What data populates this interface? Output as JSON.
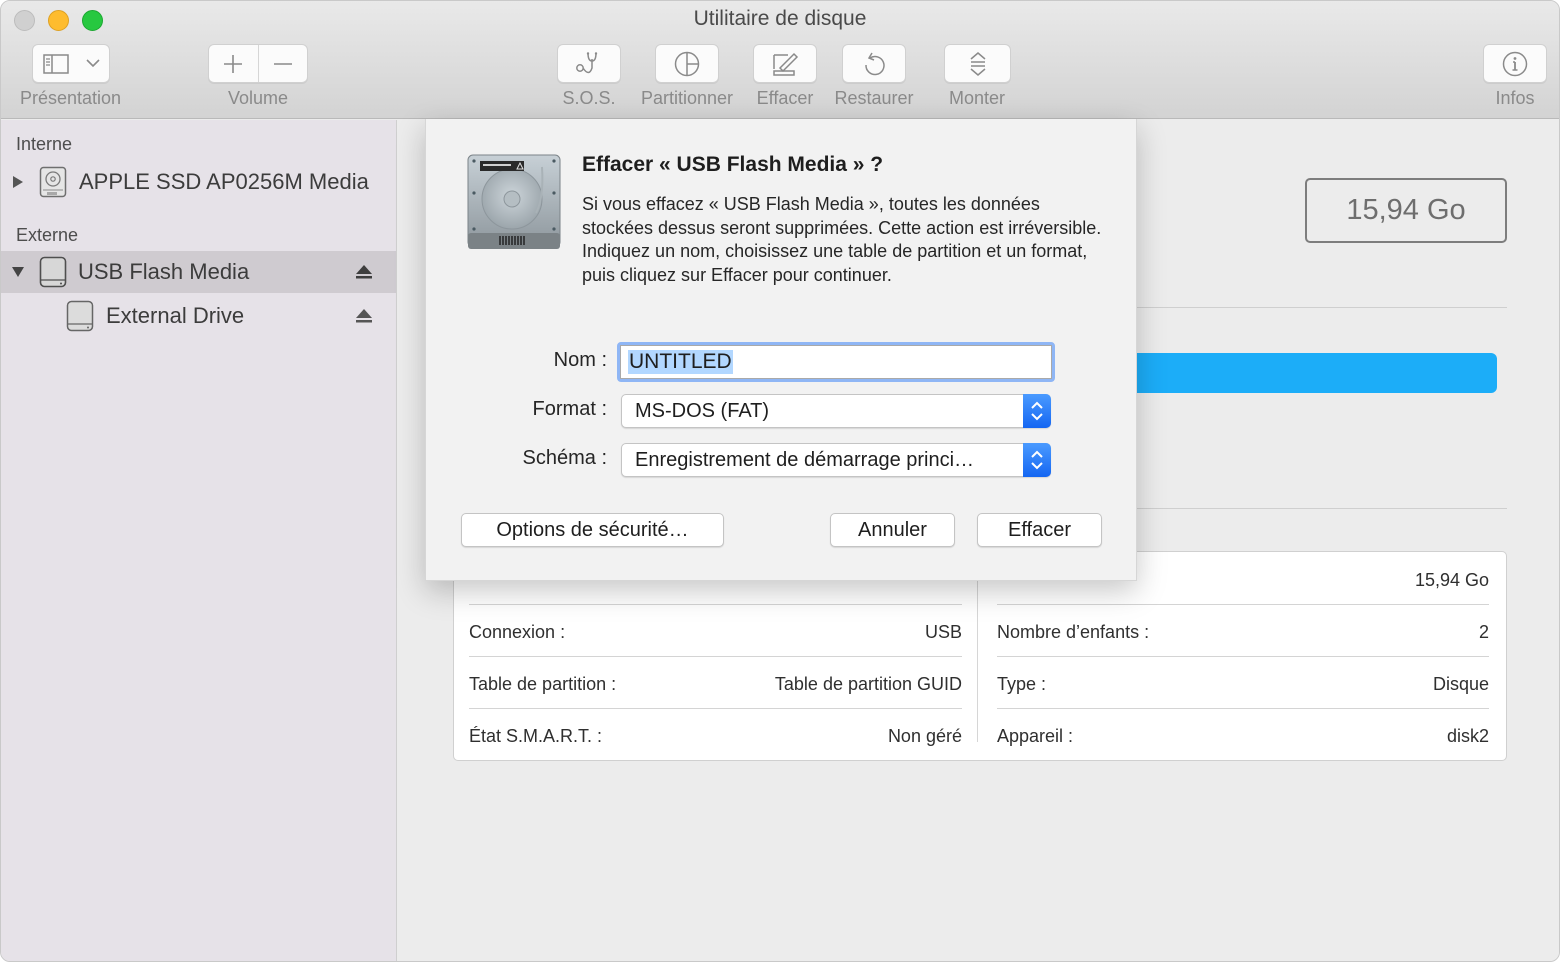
{
  "window": {
    "title": "Utilitaire de disque"
  },
  "toolbar": {
    "presentation_label": "Présentation",
    "volume_label": "Volume",
    "sos_label": "S.O.S.",
    "partition_label": "Partitionner",
    "erase_label": "Effacer",
    "restore_label": "Restaurer",
    "mount_label": "Monter",
    "info_label": "Infos",
    "icons": {
      "presentation": "sidebar-icon",
      "presentation_menu": "chevron-down-icon",
      "volume_add": "plus-icon",
      "volume_remove": "minus-icon",
      "sos": "stethoscope-icon",
      "partition": "pie-chart-icon",
      "erase": "erase-icon",
      "restore": "restore-arrow-icon",
      "mount": "mount-icon",
      "info": "info-icon"
    }
  },
  "sidebar": {
    "sections": [
      {
        "title": "Interne",
        "items": [
          {
            "label": "APPLE SSD AP0256M Media",
            "expanded": false,
            "icon": "internal-disk-icon",
            "selected": false
          }
        ]
      },
      {
        "title": "Externe",
        "items": [
          {
            "label": "USB Flash Media",
            "expanded": true,
            "icon": "external-disk-icon",
            "selected": true,
            "ejectable": true
          },
          {
            "label": "External Drive",
            "child": true,
            "icon": "external-volume-icon",
            "selected": false,
            "ejectable": true
          }
        ]
      }
    ]
  },
  "main": {
    "capacity": "15,94 Go",
    "usage_bar_color": "#1cadf8",
    "info_left": [
      {
        "label": "Connexion :",
        "value": "USB"
      },
      {
        "label": "Table de partition :",
        "value": "Table de partition GUID"
      },
      {
        "label": "État S.M.A.R.T. :",
        "value": "Non géré"
      }
    ],
    "info_right": [
      {
        "label": "",
        "value": "15,94 Go"
      },
      {
        "label": "Nombre d’enfants :",
        "value": "2"
      },
      {
        "label": "Type :",
        "value": "Disque"
      },
      {
        "label": "Appareil :",
        "value": "disk2"
      }
    ]
  },
  "dialog": {
    "title": "Effacer « USB Flash Media » ?",
    "body": "Si vous effacez « USB Flash Media », toutes les données stockées dessus seront supprimées. Cette action est irréversible. Indiquez un nom, choisissez une table de partition et un format, puis cliquez sur Effacer pour continuer.",
    "name_label": "Nom :",
    "name_value": "UNTITLED",
    "format_label": "Format :",
    "format_value": "MS-DOS (FAT)",
    "scheme_label": "Schéma :",
    "scheme_value": "Enregistrement de démarrage princi…",
    "security_button": "Options de sécurité…",
    "cancel_button": "Annuler",
    "erase_button": "Effacer",
    "accent_color": "#1a6ff4"
  }
}
